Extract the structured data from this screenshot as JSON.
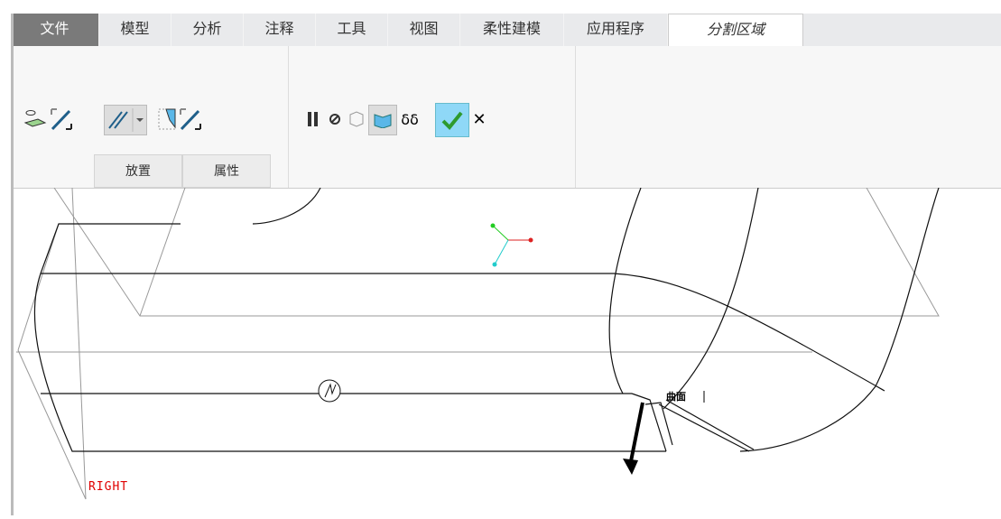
{
  "tabs": [
    "文件",
    "模型",
    "分析",
    "注释",
    "工具",
    "视图",
    "柔性建模",
    "应用程序",
    "分割区域"
  ],
  "subtabs": {
    "placement": "放置",
    "properties": "属性"
  },
  "canvas": {
    "datum_label": "RIGHT",
    "surface_label": "曲面"
  },
  "colors": {
    "file_tab": "#7a7a7a",
    "accent": "#7fd3f5",
    "check": "#2e9a2e",
    "datum": "#e00000"
  }
}
